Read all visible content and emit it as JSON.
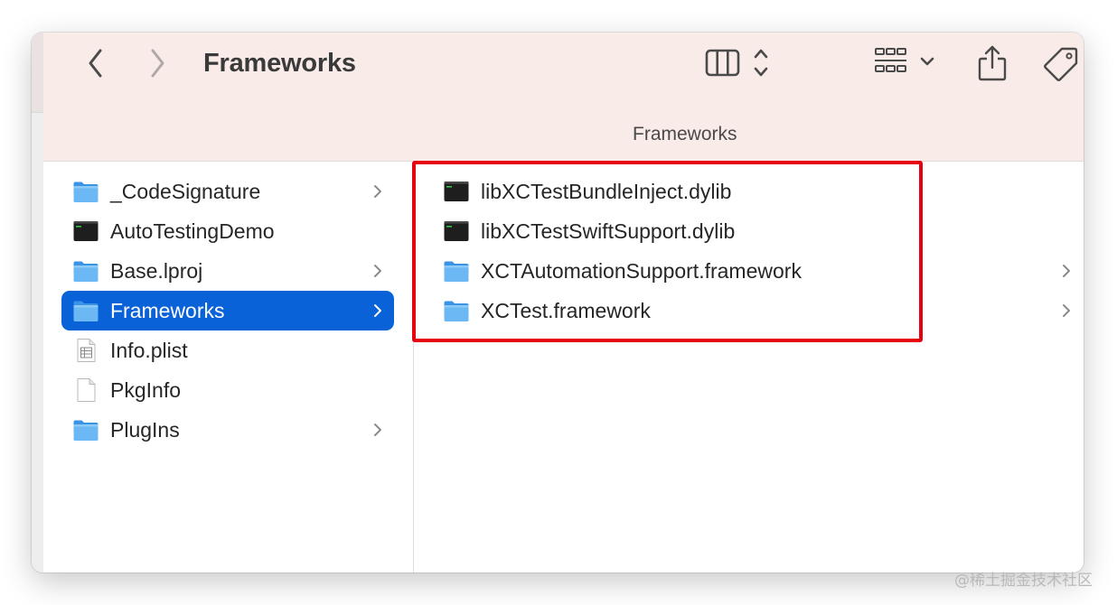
{
  "window": {
    "title": "Frameworks",
    "path_label": "Frameworks"
  },
  "toolbar": {
    "back_icon": "chevron-left-icon",
    "forward_icon": "chevron-right-icon",
    "view_icon": "columns-view-icon",
    "group_icon": "grid-group-icon",
    "share_icon": "share-icon",
    "tag_icon": "tag-icon"
  },
  "left_column": {
    "items": [
      {
        "label": "_CodeSignature",
        "icon": "folder-icon",
        "has_children": true,
        "selected": false
      },
      {
        "label": "AutoTestingDemo",
        "icon": "executable-icon",
        "has_children": false,
        "selected": false
      },
      {
        "label": "Base.lproj",
        "icon": "folder-icon",
        "has_children": true,
        "selected": false
      },
      {
        "label": "Frameworks",
        "icon": "folder-icon",
        "has_children": true,
        "selected": true
      },
      {
        "label": "Info.plist",
        "icon": "plist-file-icon",
        "has_children": false,
        "selected": false
      },
      {
        "label": "PkgInfo",
        "icon": "document-icon",
        "has_children": false,
        "selected": false
      },
      {
        "label": "PlugIns",
        "icon": "folder-icon",
        "has_children": true,
        "selected": false
      }
    ]
  },
  "right_column": {
    "items": [
      {
        "label": "libXCTestBundleInject.dylib",
        "icon": "executable-icon",
        "has_children": false
      },
      {
        "label": "libXCTestSwiftSupport.dylib",
        "icon": "executable-icon",
        "has_children": false
      },
      {
        "label": "XCTAutomationSupport.framework",
        "icon": "folder-icon",
        "has_children": true
      },
      {
        "label": "XCTest.framework",
        "icon": "folder-icon",
        "has_children": true
      }
    ]
  },
  "colors": {
    "toolbar_bg": "#f8ebe8",
    "selection": "#0a62d9",
    "highlight_box": "#e60012",
    "folder": "#4da3f0"
  },
  "watermark": "@稀土掘金技术社区"
}
